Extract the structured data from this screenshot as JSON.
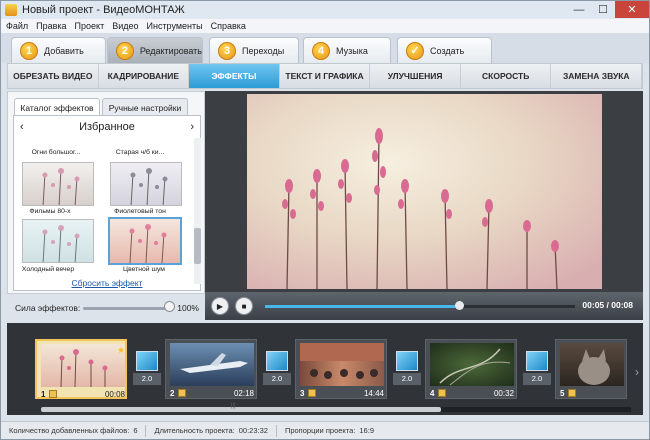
{
  "window": {
    "title": "Новый проект - ВидеоМОНТАЖ",
    "btn_min": "—",
    "btn_max": "☐",
    "btn_close": "✕"
  },
  "menu": [
    "Файл",
    "Правка",
    "Проект",
    "Видео",
    "Инструменты",
    "Справка"
  ],
  "steps": [
    {
      "num": "1",
      "label": "Добавить"
    },
    {
      "num": "2",
      "label": "Редактировать"
    },
    {
      "num": "3",
      "label": "Переходы"
    },
    {
      "num": "4",
      "label": "Музыка"
    },
    {
      "num": "✓",
      "label": "Создать"
    }
  ],
  "edit_tabs": [
    "ОБРЕЗАТЬ ВИДЕО",
    "КАДРИРОВАНИЕ",
    "ЭФФЕКТЫ",
    "ТЕКСТ И ГРАФИКА",
    "УЛУЧШЕНИЯ",
    "СКОРОСТЬ",
    "ЗАМЕНА ЗВУКА"
  ],
  "active_edit_tab": "ЭФФЕКТЫ",
  "left_panel": {
    "tab_catalog": "Каталог эффектов",
    "tab_manual": "Ручные настройки",
    "favorites": "Избранное",
    "prev": "‹",
    "next": "›",
    "effects": [
      "Огни большог...",
      "Старая ч/б ки...",
      "Фильмы 80-х",
      "Фиолетовый тон",
      "Холодный вечер",
      "Цветной шум"
    ],
    "reset": "Сбросить эффект"
  },
  "strength": {
    "label": "Сила эффектов:",
    "value": "100%",
    "level": 1.0
  },
  "player": {
    "play": "▶",
    "stop": "■",
    "time": "00:05 / 00:08",
    "progress": 0.625
  },
  "timeline": {
    "clips": [
      {
        "num": "1",
        "dur": "00:08"
      },
      {
        "num": "2",
        "dur": "02:18"
      },
      {
        "num": "3",
        "dur": "14:44"
      },
      {
        "num": "4",
        "dur": "00:32"
      },
      {
        "num": "5",
        "dur": ""
      }
    ],
    "transitions": [
      "2.0",
      "2.0",
      "2.0",
      "2.0"
    ],
    "scroll_thumb": "|||",
    "arrow": "›"
  },
  "status": {
    "files_label": "Количество добавленных файлов:",
    "files_value": "6",
    "duration_label": "Длительность проекта:",
    "duration_value": "00:23:32",
    "ratio_label": "Пропорции проекта:",
    "ratio_value": "16:9"
  }
}
